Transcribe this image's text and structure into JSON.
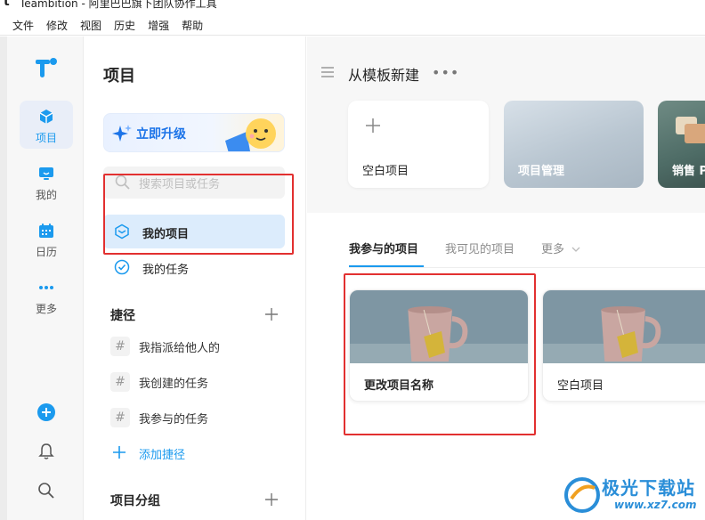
{
  "window": {
    "title": "Teambition - 阿里巴巴旗下团队协作工具"
  },
  "menubar": [
    "文件",
    "修改",
    "视图",
    "历史",
    "增强",
    "帮助"
  ],
  "rail": {
    "items": [
      {
        "label": "项目",
        "icon": "cube-icon",
        "active": true
      },
      {
        "label": "我的",
        "icon": "monitor-icon"
      },
      {
        "label": "日历",
        "icon": "calendar-icon"
      },
      {
        "label": "更多",
        "icon": "more-dots-icon"
      }
    ],
    "bottom_icons": [
      "add-circle-icon",
      "bell-icon",
      "search-icon"
    ]
  },
  "sidebar": {
    "title": "项目",
    "upgrade_label": "立即升级",
    "search_placeholder": "搜索项目或任务",
    "nav": [
      {
        "label": "我的项目",
        "icon": "project-icon",
        "active": true
      },
      {
        "label": "我的任务",
        "icon": "check-circle-icon"
      }
    ],
    "shortcuts_heading": "捷径",
    "shortcuts": [
      "我指派给他人的",
      "我创建的任务",
      "我参与的任务"
    ],
    "add_shortcut_label": "添加捷径",
    "groups_heading": "项目分组"
  },
  "templates": {
    "heading": "从模板新建",
    "more": "•••",
    "items": [
      {
        "label": "空白项目",
        "kind": "blank"
      },
      {
        "label": "项目管理",
        "kind": "image"
      },
      {
        "label": "销售 P",
        "kind": "image"
      }
    ]
  },
  "projects": {
    "tabs": [
      {
        "label": "我参与的项目",
        "active": true
      },
      {
        "label": "我可见的项目"
      },
      {
        "label": "更多"
      }
    ],
    "cards": [
      {
        "name": "更改项目名称"
      },
      {
        "name": "空白项目"
      }
    ]
  },
  "watermark": {
    "line1": "极光下载站",
    "line2": "www.xz7.com"
  },
  "colors": {
    "accent": "#1b9aee",
    "highlight": "#e23030",
    "active_bg": "#dcecfc"
  }
}
